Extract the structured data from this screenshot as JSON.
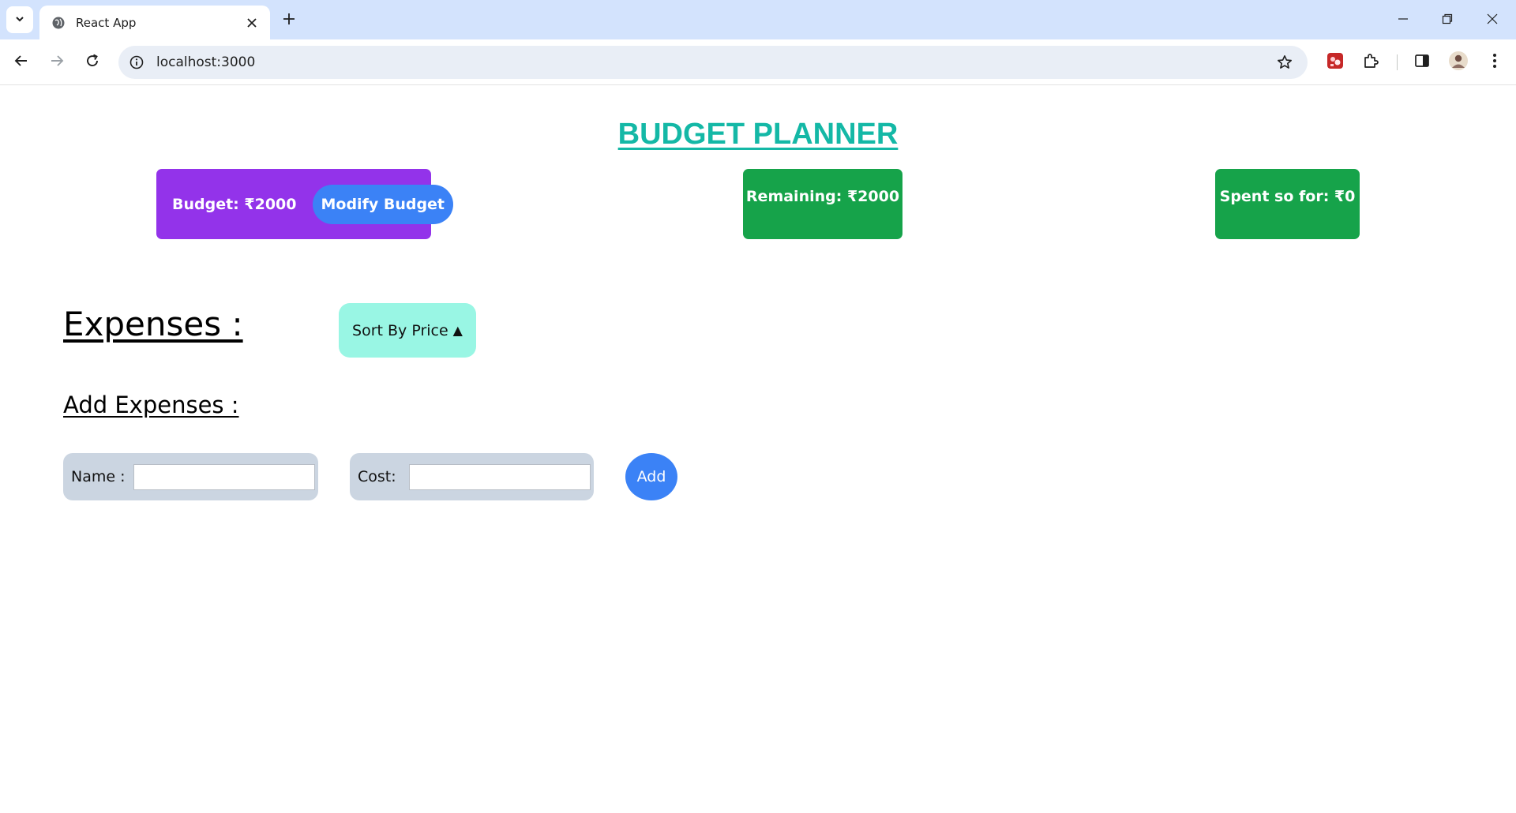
{
  "browser": {
    "tab_title": "React App",
    "url": "localhost:3000",
    "icons": {
      "tab_search": "chevron-down-icon",
      "favicon": "globe-icon",
      "tab_close": "close-icon",
      "new_tab": "plus-icon",
      "back": "arrow-left-icon",
      "forward": "arrow-right-icon",
      "reload": "reload-icon",
      "site_info": "info-icon",
      "bookmark": "star-icon",
      "extension": "puzzle-icon",
      "side_panel": "side-panel-icon",
      "profile": "avatar",
      "menu": "kebab-menu-icon"
    }
  },
  "app": {
    "title": "BUDGET PLANNER",
    "budget_label": "Budget: ₹2000",
    "modify_button": "Modify Budget",
    "remaining_label": "Remaining: ₹2000",
    "spent_label": "Spent so for: ₹0",
    "expenses_heading": "Expenses :",
    "sort_button": "Sort By Price",
    "sort_indicator": "▲",
    "add_heading": "Add Expenses :",
    "name_label": "Name :",
    "name_value": "",
    "cost_label": "Cost:",
    "cost_value": "",
    "add_button": "Add"
  },
  "colors": {
    "title": "#14b8a6",
    "budget_card": "#9333ea",
    "modify_button": "#3b82f6",
    "remaining_card": "#16a34a",
    "spent_card": "#16a34a",
    "sort_button": "#99f6e4",
    "field_box": "#cbd5e1",
    "add_button": "#3b82f6",
    "chrome_tabstrip": "#d3e3fd"
  }
}
